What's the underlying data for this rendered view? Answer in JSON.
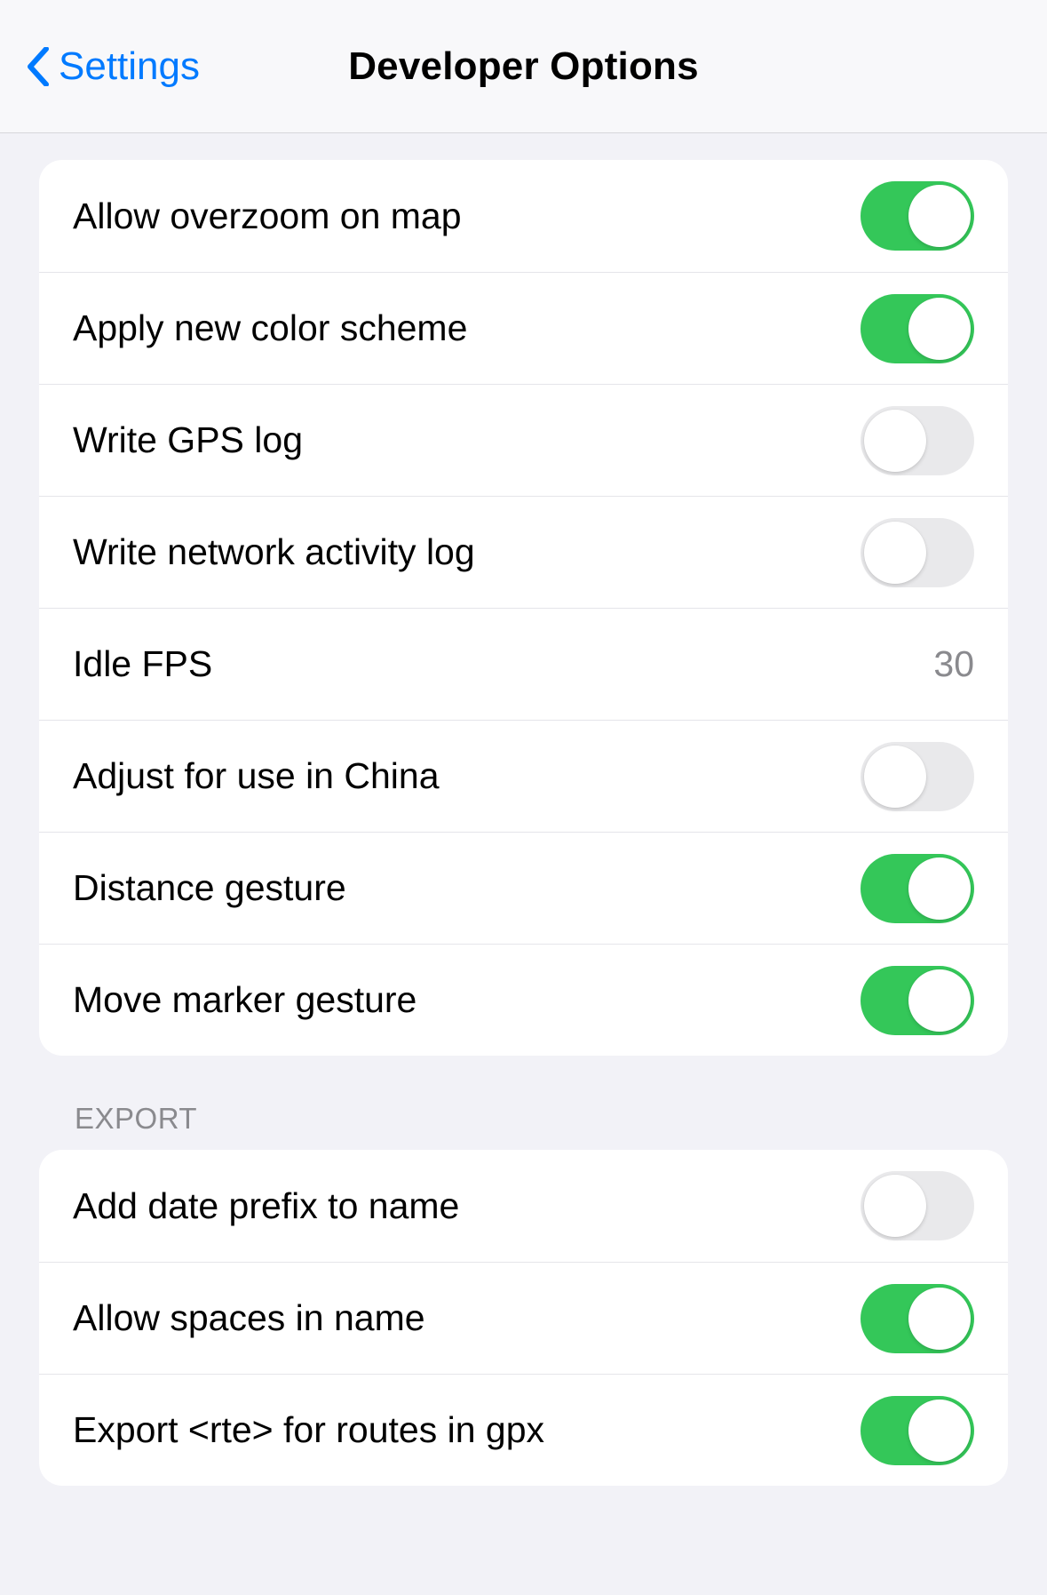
{
  "nav": {
    "back_label": "Settings",
    "title": "Developer Options"
  },
  "sections": {
    "main": {
      "rows": [
        {
          "id": "allow-overzoom",
          "label": "Allow overzoom on map",
          "type": "toggle",
          "on": true
        },
        {
          "id": "apply-color-scheme",
          "label": "Apply new color scheme",
          "type": "toggle",
          "on": true
        },
        {
          "id": "write-gps-log",
          "label": "Write GPS log",
          "type": "toggle",
          "on": false
        },
        {
          "id": "write-net-log",
          "label": "Write network activity log",
          "type": "toggle",
          "on": false
        },
        {
          "id": "idle-fps",
          "label": "Idle FPS",
          "type": "value",
          "value": "30"
        },
        {
          "id": "adjust-china",
          "label": "Adjust for use in China",
          "type": "toggle",
          "on": false
        },
        {
          "id": "distance-gesture",
          "label": "Distance gesture",
          "type": "toggle",
          "on": true
        },
        {
          "id": "move-marker-gesture",
          "label": "Move marker gesture",
          "type": "toggle",
          "on": true
        }
      ]
    },
    "export": {
      "header": "EXPORT",
      "rows": [
        {
          "id": "date-prefix",
          "label": "Add date prefix to name",
          "type": "toggle",
          "on": false
        },
        {
          "id": "allow-spaces",
          "label": "Allow spaces in name",
          "type": "toggle",
          "on": true
        },
        {
          "id": "export-rte",
          "label": "Export <rte> for routes in gpx",
          "type": "toggle",
          "on": true
        }
      ]
    }
  }
}
